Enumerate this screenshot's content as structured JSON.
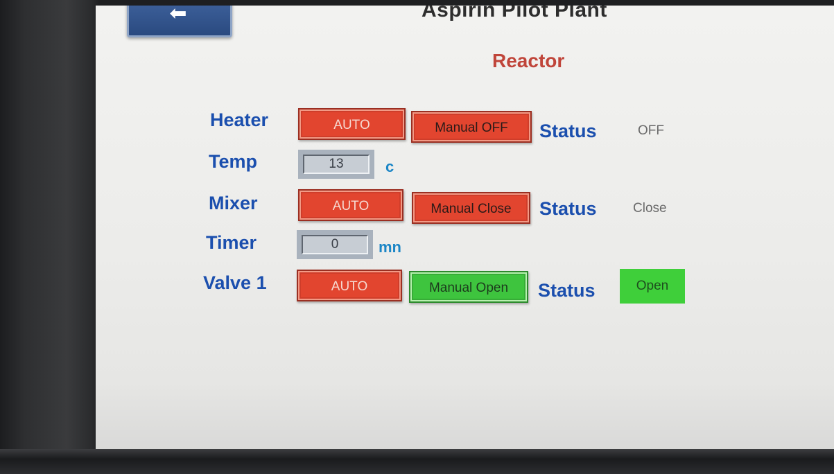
{
  "header": {
    "back_icon": "left-arrow-icon",
    "plant_title": "Aspirin Pilot Plant",
    "section_title": "Reactor"
  },
  "heater": {
    "label": "Heater",
    "auto_label": "AUTO",
    "manual_label": "Manual OFF",
    "status_label": "Status",
    "status_value": "OFF"
  },
  "temp": {
    "label": "Temp",
    "value": "13",
    "unit": "c"
  },
  "mixer": {
    "label": "Mixer",
    "auto_label": "AUTO",
    "manual_label": "Manual Close",
    "status_label": "Status",
    "status_value": "Close"
  },
  "timer": {
    "label": "Timer",
    "value": "0",
    "unit": "mn"
  },
  "valve1": {
    "label": "Valve 1",
    "auto_label": "AUTO",
    "manual_label": "Manual Open",
    "status_label": "Status",
    "status_value": "Open"
  },
  "colors": {
    "label_blue": "#1b4fae",
    "title_red": "#c0453a",
    "button_red": "#e2452f",
    "button_green": "#3ec43e",
    "status_green": "#3fcf3a",
    "unit_blue": "#1c86c6"
  }
}
